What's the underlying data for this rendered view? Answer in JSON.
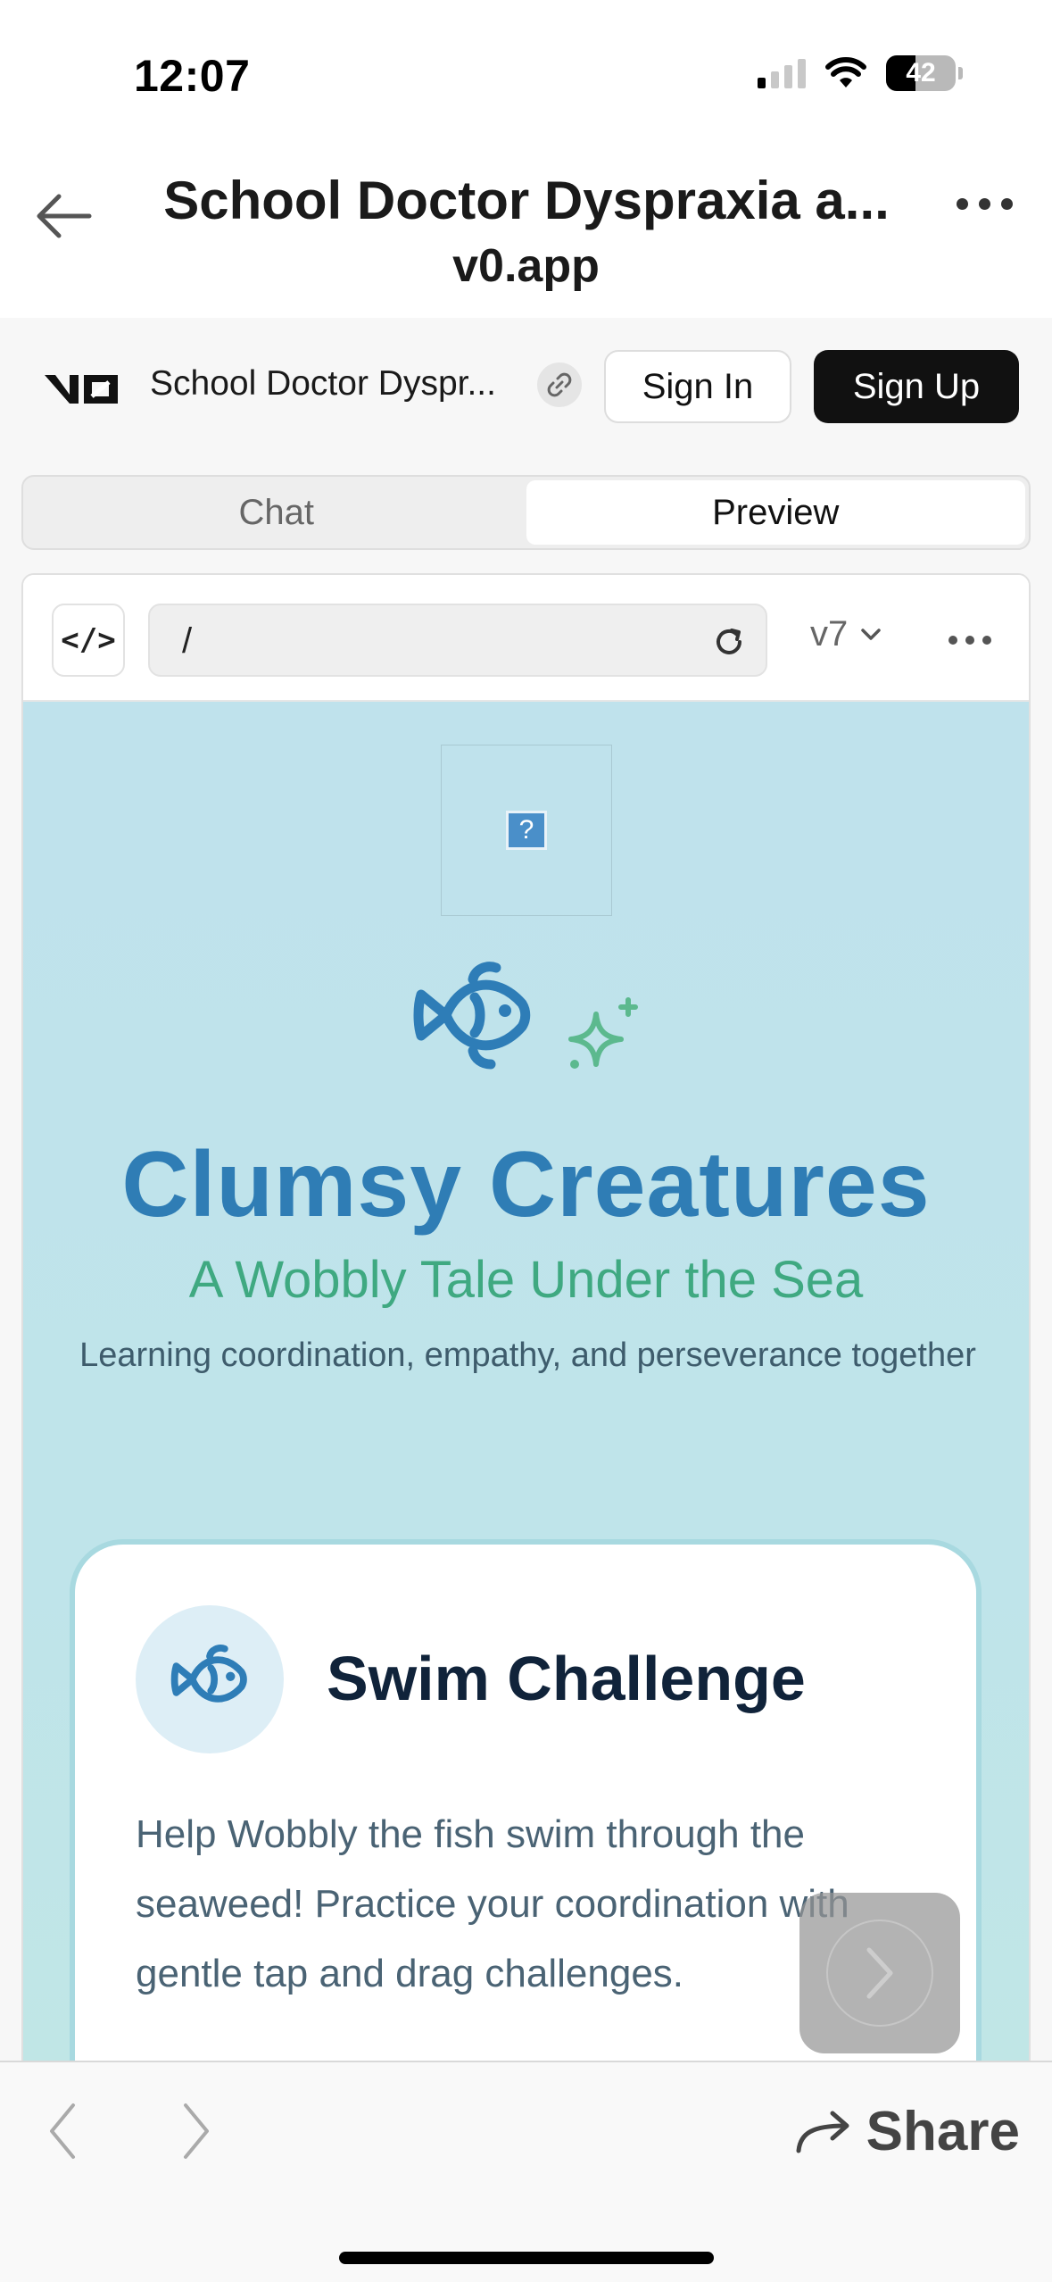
{
  "status_bar": {
    "time": "12:07",
    "battery": "42"
  },
  "browser": {
    "title": "School Doctor Dyspraxia a...",
    "domain": "v0.app"
  },
  "v0": {
    "project_name": "School Doctor Dyspr...",
    "sign_in": "Sign In",
    "sign_up": "Sign Up",
    "tabs": [
      {
        "label": "Chat",
        "active": false
      },
      {
        "label": "Preview",
        "active": true
      }
    ],
    "toolbar": {
      "code_label": "</>",
      "url": "/",
      "version": "v7"
    }
  },
  "app": {
    "broken_image_glyph": "?",
    "title": "Clumsy Creatures",
    "subtitle": "A Wobbly Tale Under the Sea",
    "description": "Learning coordination, empathy, and perseverance together",
    "card": {
      "title": "Swim Challenge",
      "text": "Help Wobbly the fish swim through the seaweed! Practice your coordination with gentle tap and drag challenges."
    }
  },
  "bottom_bar": {
    "share_label": "Share"
  },
  "colors": {
    "title_blue": "#2f7db5",
    "subtitle_green": "#3fa981",
    "app_background": "#bfe2ec",
    "sign_up_bg": "#111111"
  },
  "icons": [
    "back-arrow-icon",
    "more-icon",
    "v0-logo",
    "link-icon",
    "code-icon",
    "reload-icon",
    "chevron-down-icon",
    "broken-image-icon",
    "fish-icon",
    "sparkle-icon",
    "chevron-right-icon",
    "share-icon"
  ]
}
